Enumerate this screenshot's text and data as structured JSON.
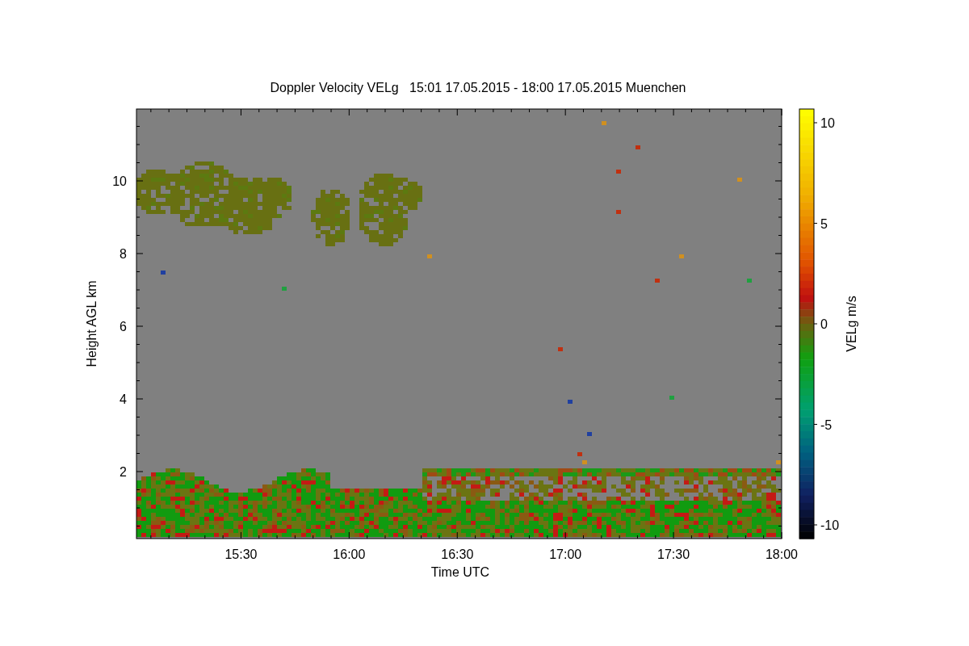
{
  "plot": {
    "title": "Doppler Velocity VELg   15:01 17.05.2015 - 18:00 17.05.2015 Muenchen",
    "xlabel": "Time UTC",
    "ylabel": "Height AGL km",
    "xticks": [
      "15:30",
      "16:00",
      "16:30",
      "17:00",
      "17:30",
      "18:00"
    ],
    "yticks": [
      "10",
      "8",
      "6",
      "4",
      "2"
    ]
  },
  "colorbar": {
    "label": "VELg m/s",
    "ticks": [
      "10",
      "5",
      "0",
      "-5",
      "-10"
    ]
  }
}
